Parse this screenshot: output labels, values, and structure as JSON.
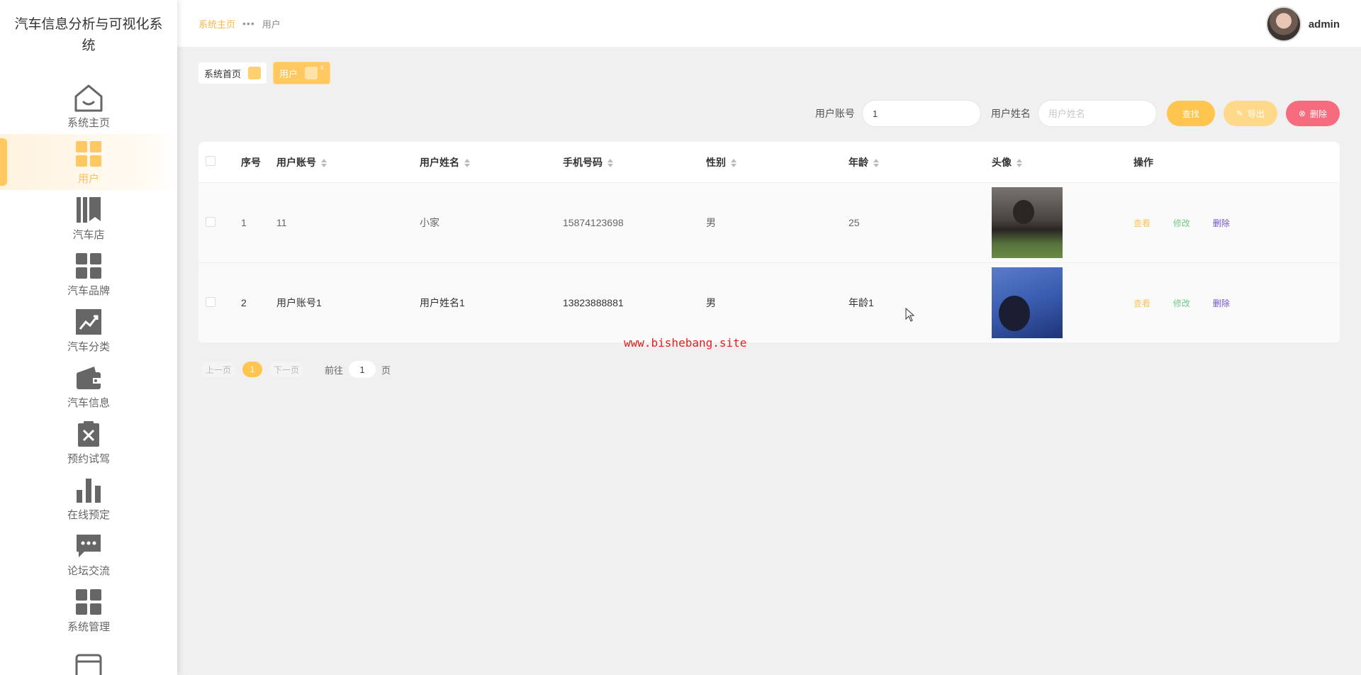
{
  "app": {
    "title": "汽车信息分析与可视化系统"
  },
  "sidebar": {
    "items": [
      {
        "label": "系统主页",
        "icon": "home-icon"
      },
      {
        "label": "用户",
        "icon": "grid-icon",
        "active": true
      },
      {
        "label": "汽车店",
        "icon": "bookmark-icon"
      },
      {
        "label": "汽车品牌",
        "icon": "grid-icon"
      },
      {
        "label": "汽车分类",
        "icon": "chart-trend-icon"
      },
      {
        "label": "汽车信息",
        "icon": "wallet-icon"
      },
      {
        "label": "预约试驾",
        "icon": "clipboard-x-icon"
      },
      {
        "label": "在线预定",
        "icon": "bar-chart-icon"
      },
      {
        "label": "论坛交流",
        "icon": "chat-icon"
      },
      {
        "label": "系统管理",
        "icon": "grid-icon"
      }
    ]
  },
  "topbar": {
    "breadcrumb": {
      "home": "系统主页",
      "sep": "•••",
      "current": "用户"
    },
    "user": {
      "name": "admin"
    }
  },
  "tags": [
    {
      "label": "系统首页"
    },
    {
      "label": "用户",
      "close": "x"
    }
  ],
  "search": {
    "account_label": "用户账号",
    "account_value": "1",
    "name_label": "用户姓名",
    "name_placeholder": "用户姓名",
    "find_label": "查找",
    "export_label": "导出",
    "delete_label": "删除"
  },
  "table": {
    "headers": [
      "序号",
      "用户账号",
      "用户姓名",
      "手机号码",
      "性别",
      "年龄",
      "头像",
      "操作"
    ],
    "rows": [
      {
        "no": "1",
        "account": "11",
        "name": "小家",
        "phone": "15874123698",
        "sex": "男",
        "age": "25"
      },
      {
        "no": "2",
        "account": "用户账号1",
        "name": "用户姓名1",
        "phone": "13823888881",
        "sex": "男",
        "age": "年龄1"
      }
    ],
    "actions": {
      "view": "查看",
      "edit": "修改",
      "delete": "删除"
    }
  },
  "pager": {
    "prev": "上一页",
    "page": "1",
    "next": "下一页",
    "goto_prefix": "前往",
    "goto_value": "1",
    "goto_suffix": "页"
  },
  "watermark": "www.bishebang.site",
  "colors": {
    "accent": "#ffc54f",
    "danger": "#f76b7f",
    "edit": "#73c98a",
    "delete_link": "#7055c8"
  }
}
